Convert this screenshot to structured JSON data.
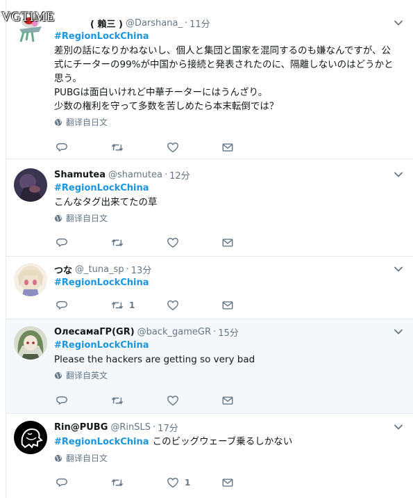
{
  "watermark": "VGTIME",
  "tweets": [
    {
      "name": "　　　　( 賴三 )",
      "handle": "@Darshana_",
      "time": "11分",
      "hashtag": "#RegionLockChina",
      "lines": [
        "差別の話になりかねないし、個人と集団と国家を混同するのも嫌なんですが、公",
        "式にチーターの99%が中国から接続と発表されたのに、隔離しないのはどうかと",
        "思う。",
        "PUBGは面白いけれど中華チーターにはうんざり。",
        "少数の権利を守って多数を苦しめたら本末転倒では？"
      ],
      "translate": "翻译自日文",
      "retweets": "",
      "likes": ""
    },
    {
      "name": "Shamutea",
      "handle": "@shamutea",
      "time": "12分",
      "hashtag": "#RegionLockChina",
      "lines": [
        "こんなタグ出来てたの草"
      ],
      "translate": "翻译自日文",
      "retweets": "",
      "likes": ""
    },
    {
      "name": "つな",
      "handle": "@_tuna_sp",
      "time": "13分",
      "hashtag": "#RegionLockChina",
      "lines": [],
      "translate": "",
      "retweets": "1",
      "likes": ""
    },
    {
      "name": "ОлесамаГР(GR)",
      "handle": "@back_gameGR",
      "time": "15分",
      "hashtag": "#RegionLockChina",
      "lines": [
        "Please the hackers are getting so very bad"
      ],
      "translate": "翻译自英文",
      "retweets": "",
      "likes": ""
    },
    {
      "name": "Rin@PUBG",
      "handle": "@RinSLS",
      "time": "17分",
      "hashtag": "#RegionLockChina",
      "inline_text": "このビッグウェーブ乗るしかない",
      "lines": [],
      "translate": "翻译自日文",
      "retweets": "",
      "likes": "1"
    }
  ],
  "icons": {
    "reply": "reply-icon",
    "retweet": "retweet-icon",
    "like": "heart-icon",
    "dm": "envelope-icon",
    "menu": "chevron-down-icon",
    "translate": "globe-icon"
  },
  "colors": {
    "link": "#1b95e0",
    "muted": "#657786",
    "highlight_bg": "#f5f8fa"
  }
}
